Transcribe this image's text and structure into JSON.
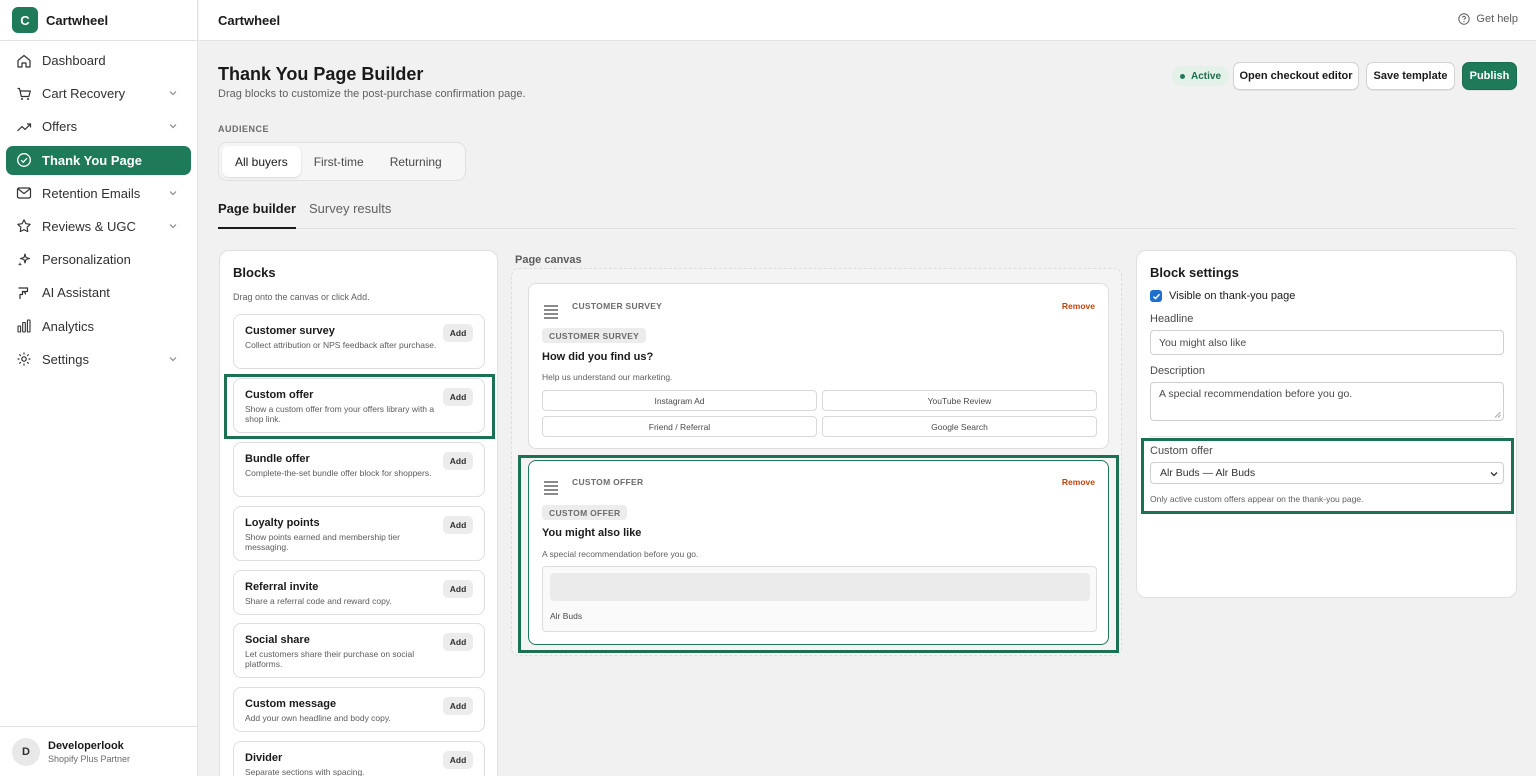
{
  "app": {
    "logo_letter": "C",
    "name": "Cartwheel",
    "help": "Get help"
  },
  "nav": [
    {
      "label": "Dashboard",
      "icon": "home-icon"
    },
    {
      "label": "Cart Recovery",
      "icon": "cart-icon",
      "chevron": true
    },
    {
      "label": "Offers",
      "icon": "trend-icon",
      "chevron": true
    },
    {
      "label": "Thank You Page",
      "icon": "check-circle-icon",
      "active": true
    },
    {
      "label": "Retention Emails",
      "icon": "mail-icon",
      "chevron": true
    },
    {
      "label": "Reviews & UGC",
      "icon": "star-icon",
      "chevron": true
    },
    {
      "label": "Personalization",
      "icon": "sparkle-icon"
    },
    {
      "label": "AI Assistant",
      "icon": "ai-icon"
    },
    {
      "label": "Analytics",
      "icon": "bar-chart-icon"
    },
    {
      "label": "Settings",
      "icon": "gear-icon",
      "chevron": true
    }
  ],
  "user": {
    "initial": "D",
    "name": "Developerlook",
    "role": "Shopify Plus Partner"
  },
  "header": {
    "title": "Thank You Page Builder",
    "subtitle": "Drag blocks to customize the post-purchase confirmation page.",
    "status": "Active",
    "open_checkout": "Open checkout editor",
    "save_template": "Save template",
    "publish": "Publish"
  },
  "audience": {
    "label": "AUDIENCE",
    "options": [
      "All buyers",
      "First-time",
      "Returning"
    ],
    "selected": "All buyers"
  },
  "tabs": [
    "Page builder",
    "Survey results"
  ],
  "blocks": {
    "title": "Blocks",
    "hint": "Drag onto the canvas or click Add.",
    "add_label": "Add",
    "items": [
      {
        "name": "Customer survey",
        "desc": "Collect attribution or NPS feedback after purchase."
      },
      {
        "name": "Custom offer",
        "desc": "Show a custom offer from your offers library with a shop link."
      },
      {
        "name": "Bundle offer",
        "desc": "Complete-the-set bundle offer block for shoppers."
      },
      {
        "name": "Loyalty points",
        "desc": "Show points earned and membership tier messaging."
      },
      {
        "name": "Referral invite",
        "desc": "Share a referral code and reward copy."
      },
      {
        "name": "Social share",
        "desc": "Let customers share their purchase on social platforms."
      },
      {
        "name": "Custom message",
        "desc": "Add your own headline and body copy."
      },
      {
        "name": "Divider",
        "desc": "Separate sections with spacing."
      }
    ]
  },
  "canvas": {
    "label": "Page canvas",
    "remove": "Remove",
    "survey": {
      "type": "CUSTOMER SURVEY",
      "tag": "CUSTOMER SURVEY",
      "headline": "How did you find us?",
      "desc": "Help us understand our marketing.",
      "options": [
        "Instagram Ad",
        "YouTube Review",
        "Friend / Referral",
        "Google Search"
      ]
    },
    "offer": {
      "type": "CUSTOM OFFER",
      "tag": "CUSTOM OFFER",
      "headline": "You might also like",
      "desc": "A special recommendation before you go.",
      "product": "Alr Buds"
    }
  },
  "settings": {
    "title": "Block settings",
    "visible_label": "Visible on thank-you page",
    "headline_label": "Headline",
    "headline_value": "You might also like",
    "description_label": "Description",
    "description_value": "A special recommendation before you go.",
    "offer_label": "Custom offer",
    "offer_value": "Alr Buds — Alr Buds",
    "offer_help": "Only active custom offers appear on the thank-you page."
  },
  "colors": {
    "brand": "#1f7a5a",
    "remove": "#c0440f",
    "highlight": "#1a7253"
  }
}
